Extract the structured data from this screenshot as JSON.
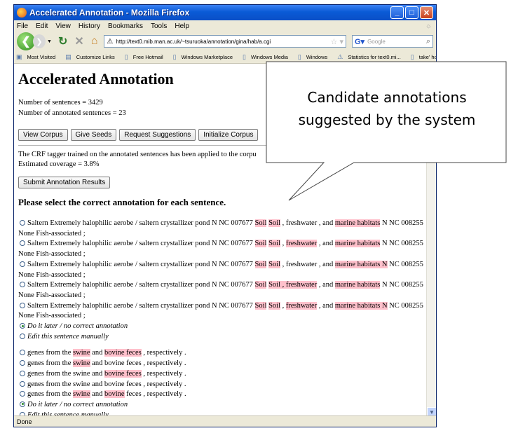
{
  "window": {
    "title": "Accelerated Annotation - Mozilla Firefox",
    "controls": [
      "_",
      "□",
      "✕"
    ]
  },
  "menu": [
    "File",
    "Edit",
    "View",
    "History",
    "Bookmarks",
    "Tools",
    "Help"
  ],
  "nav": {
    "url": "http://text0.mib.man.ac.uk/~tsuruoka/annotation/gina/hab/a.cgi",
    "search_placeholder": "Google"
  },
  "bookmarks": [
    "Most Visited",
    "Customize Links",
    "Free Hotmail",
    "Windows Marketplace",
    "Windows Media",
    "Windows",
    "Statistics for text0.mi...",
    "take' home page"
  ],
  "page": {
    "title": "Accelerated Annotation",
    "stats": [
      "Number of sentences = 3429",
      "Number of annotated sentences = 23"
    ],
    "buttons": [
      "View Corpus",
      "Give Seeds",
      "Request Suggestions",
      "Initialize Corpus"
    ],
    "crf_line": "The CRF tagger trained on the annotated sentences has been applied to the corpu",
    "coverage": "Estimated coverage = 3.8%",
    "submit_label": "Submit Annotation Results",
    "section_heading": "Please select the correct annotation for each sentence.",
    "group1": [
      [
        [
          "t",
          "Saltern Extremely halophilic aerobe / saltern crystallizer pond N NC 007677 "
        ],
        [
          "h",
          "Soil"
        ],
        [
          "t",
          " "
        ],
        [
          "h",
          "Soil"
        ],
        [
          "t",
          " , freshwater , and "
        ],
        [
          "h",
          "marine habitats"
        ],
        [
          "t",
          " N NC 008255 None Fish-associated ;"
        ]
      ],
      [
        [
          "t",
          "Saltern Extremely halophilic aerobe / saltern crystallizer pond N NC 007677 "
        ],
        [
          "h",
          "Soil"
        ],
        [
          "t",
          " "
        ],
        [
          "h",
          "Soil"
        ],
        [
          "t",
          " , "
        ],
        [
          "h",
          "freshwater"
        ],
        [
          "t",
          " , and "
        ],
        [
          "h",
          "marine habitats"
        ],
        [
          "t",
          " N NC 008255 None Fish-associated ;"
        ]
      ],
      [
        [
          "t",
          "Saltern Extremely halophilic aerobe / saltern crystallizer pond N NC 007677 "
        ],
        [
          "h",
          "Soil"
        ],
        [
          "t",
          " "
        ],
        [
          "h",
          "Soil"
        ],
        [
          "t",
          " , freshwater , and "
        ],
        [
          "h",
          "marine habitats N"
        ],
        [
          "t",
          " NC 008255 None Fish-associated ;"
        ]
      ],
      [
        [
          "t",
          "Saltern Extremely halophilic aerobe / saltern crystallizer pond N NC 007677 "
        ],
        [
          "h",
          "Soil"
        ],
        [
          "t",
          " "
        ],
        [
          "h",
          "Soil , freshwater"
        ],
        [
          "t",
          " , and "
        ],
        [
          "h",
          "marine habitats"
        ],
        [
          "t",
          " N NC 008255 None Fish-associated ;"
        ]
      ],
      [
        [
          "t",
          "Saltern Extremely halophilic aerobe / saltern crystallizer pond N NC 007677 "
        ],
        [
          "h",
          "Soil"
        ],
        [
          "t",
          " "
        ],
        [
          "h",
          "Soil"
        ],
        [
          "t",
          " , "
        ],
        [
          "h",
          "freshwater"
        ],
        [
          "t",
          " , and "
        ],
        [
          "h",
          "marine habitats N"
        ],
        [
          "t",
          " NC 008255 None Fish-associated ;"
        ]
      ]
    ],
    "group2": [
      [
        [
          "t",
          "genes from the "
        ],
        [
          "h",
          "swine"
        ],
        [
          "t",
          " and "
        ],
        [
          "h",
          "bovine feces"
        ],
        [
          "t",
          " , respectively ."
        ]
      ],
      [
        [
          "t",
          "genes from the "
        ],
        [
          "h",
          "swine"
        ],
        [
          "t",
          " and bovine feces , respectively ."
        ]
      ],
      [
        [
          "t",
          "genes from the swine and "
        ],
        [
          "h",
          "bovine feces"
        ],
        [
          "t",
          " , respectively ."
        ]
      ],
      [
        [
          "t",
          "genes from the swine and bovine feces , respectively ."
        ]
      ],
      [
        [
          "t",
          "genes from the "
        ],
        [
          "h",
          "swine"
        ],
        [
          "t",
          " and "
        ],
        [
          "h",
          "bovine"
        ],
        [
          "t",
          " feces , respectively ."
        ]
      ]
    ],
    "do_later": "Do it later / no correct annotation",
    "edit_manually": "Edit this sentence manually"
  },
  "status": "Done",
  "callout": {
    "line1": "Candidate annotations",
    "line2": "suggested by the system"
  }
}
